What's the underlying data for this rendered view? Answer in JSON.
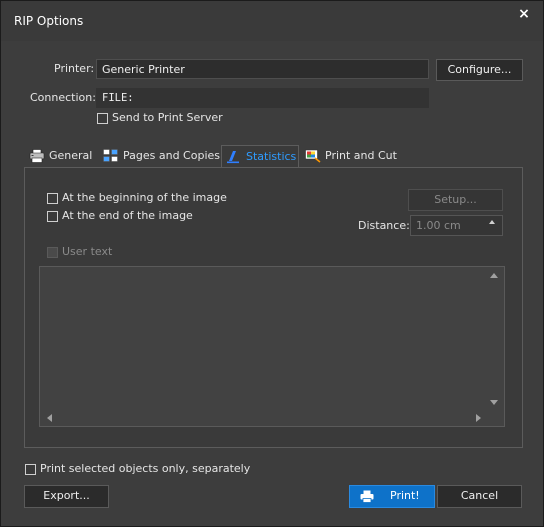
{
  "window": {
    "title": "RIP Options",
    "close_glyph": "×"
  },
  "printer": {
    "label": "Printer:",
    "value": "Generic Printer",
    "configure_label": "Configure..."
  },
  "connection": {
    "label": "Connection:",
    "value": "FILE:",
    "send_to_server_label": "Send to Print Server",
    "send_to_server_checked": false
  },
  "tabs": [
    {
      "label": "General",
      "icon": "printer-icon",
      "active": false
    },
    {
      "label": "Pages and Copies",
      "icon": "pages-grid-icon",
      "active": false
    },
    {
      "label": "Statistics",
      "icon": "statistics-icon",
      "active": true
    },
    {
      "label": "Print and Cut",
      "icon": "print-and-cut-icon",
      "active": false
    }
  ],
  "statistics": {
    "beginning_label": "At the beginning of the image",
    "beginning_checked": false,
    "end_label": "At the end of the image",
    "end_checked": false,
    "setup_label": "Setup...",
    "distance_label": "Distance:",
    "distance_value": "1.00 cm",
    "user_text_label": "User text",
    "user_text_checked": false,
    "user_text_value": ""
  },
  "footer": {
    "print_selected_label": "Print selected objects only, separately",
    "print_selected_checked": false,
    "export_label": "Export...",
    "print_label": "Print!",
    "cancel_label": "Cancel"
  },
  "colors": {
    "accent": "#0e72c9",
    "active_tab_text": "#2f9cff",
    "background": "#3c3c3c"
  }
}
